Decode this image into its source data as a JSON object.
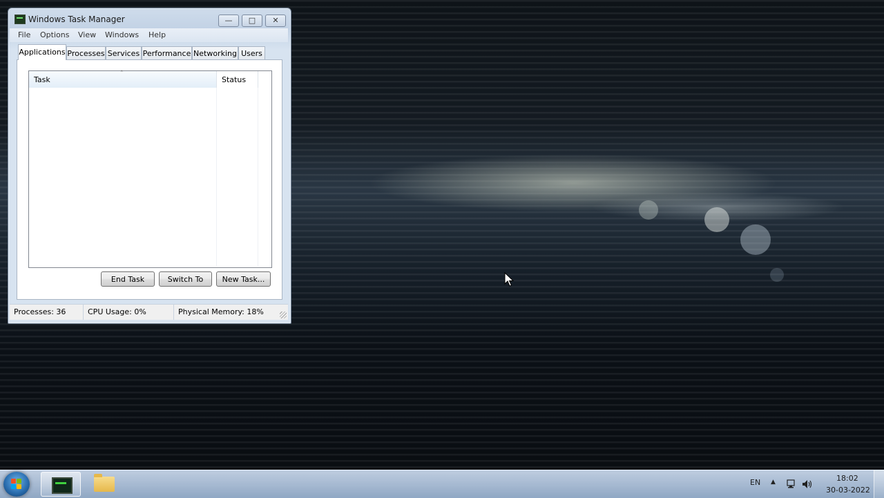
{
  "window": {
    "title": "Windows Task Manager",
    "controls": [
      "minimize",
      "maximize",
      "close"
    ]
  },
  "menu": [
    "File",
    "Options",
    "View",
    "Windows",
    "Help"
  ],
  "tabs": [
    "Applications",
    "Processes",
    "Services",
    "Performance",
    "Networking",
    "Users"
  ],
  "active_tab": "Applications",
  "task_list": {
    "columns": [
      "Task",
      "Status"
    ],
    "sort_indicator": "ˆ",
    "rows": []
  },
  "buttons": {
    "end_task": "End Task",
    "switch_to": "Switch To",
    "new_task": "New Task..."
  },
  "statusbar": {
    "processes": "Processes: 36",
    "cpu": "CPU Usage: 0%",
    "memory": "Physical Memory: 18%"
  },
  "taskbar": {
    "pinned": [
      "Windows Task Manager",
      "Windows Explorer"
    ],
    "tray": {
      "language": "EN",
      "time": "18:02",
      "date": "30-03-2022"
    }
  },
  "icons": {
    "window": "task-manager-icon",
    "minimize": "minimize-icon",
    "maximize": "maximize-icon",
    "close": "close-icon",
    "start": "windows-start-icon",
    "explorer": "folder-icon",
    "network": "network-icon",
    "volume": "volume-icon",
    "tray_expand": "chevron-up-icon"
  }
}
